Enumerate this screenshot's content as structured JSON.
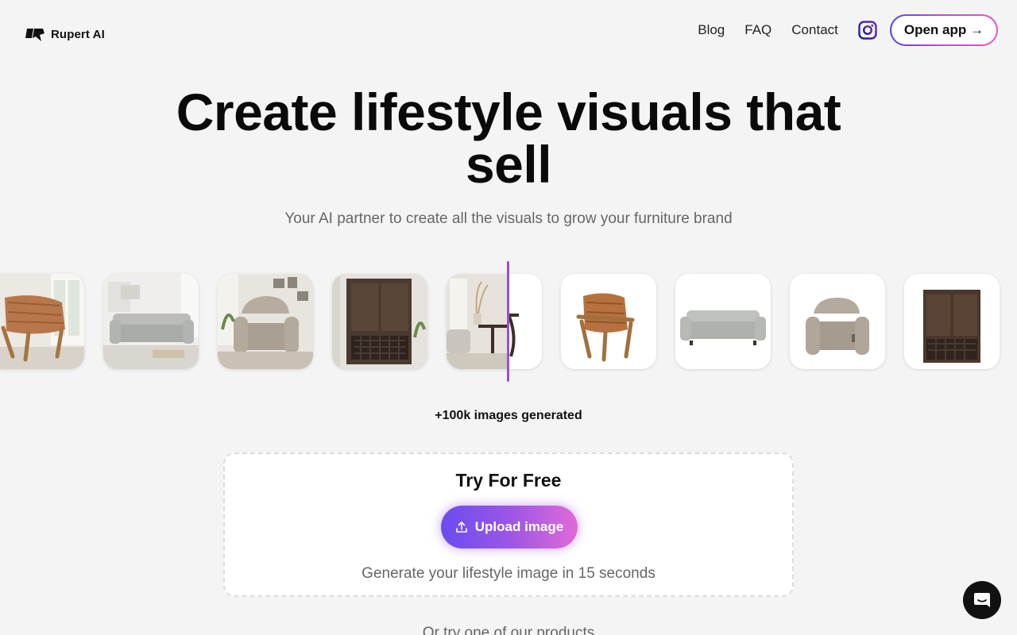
{
  "brand": {
    "name": "Rupert AI"
  },
  "nav": {
    "links": [
      "Blog",
      "FAQ",
      "Contact"
    ],
    "instagram_icon": "instagram-icon",
    "open_app_label": "Open app →",
    "accent_gradient": [
      "#5b3fe6",
      "#c04bd8",
      "#e45ab8"
    ]
  },
  "hero": {
    "title_line1": "Create lifestyle visuals that",
    "title_line2": "sell",
    "subtitle": "Your AI partner to create all the visuals to grow your furniture brand"
  },
  "carousel": {
    "tiles": [
      "leather armchair lifestyle",
      "grey sofa lifestyle",
      "recliner lifestyle",
      "hall tree cabinet lifestyle",
      "side table lifestyle / product split",
      "leather armchair product",
      "grey sofa product",
      "recliner product",
      "hall tree cabinet product"
    ],
    "divider_color": "#9b4fd1"
  },
  "counter": {
    "text": "+100k images generated"
  },
  "upload": {
    "title": "Try For Free",
    "button_label": "Upload image",
    "upload_icon": "upload-icon",
    "caption": "Generate your lifestyle image in 15 seconds"
  },
  "more": {
    "text": "Or try one of our products"
  },
  "chat": {
    "icon": "chat-icon"
  }
}
